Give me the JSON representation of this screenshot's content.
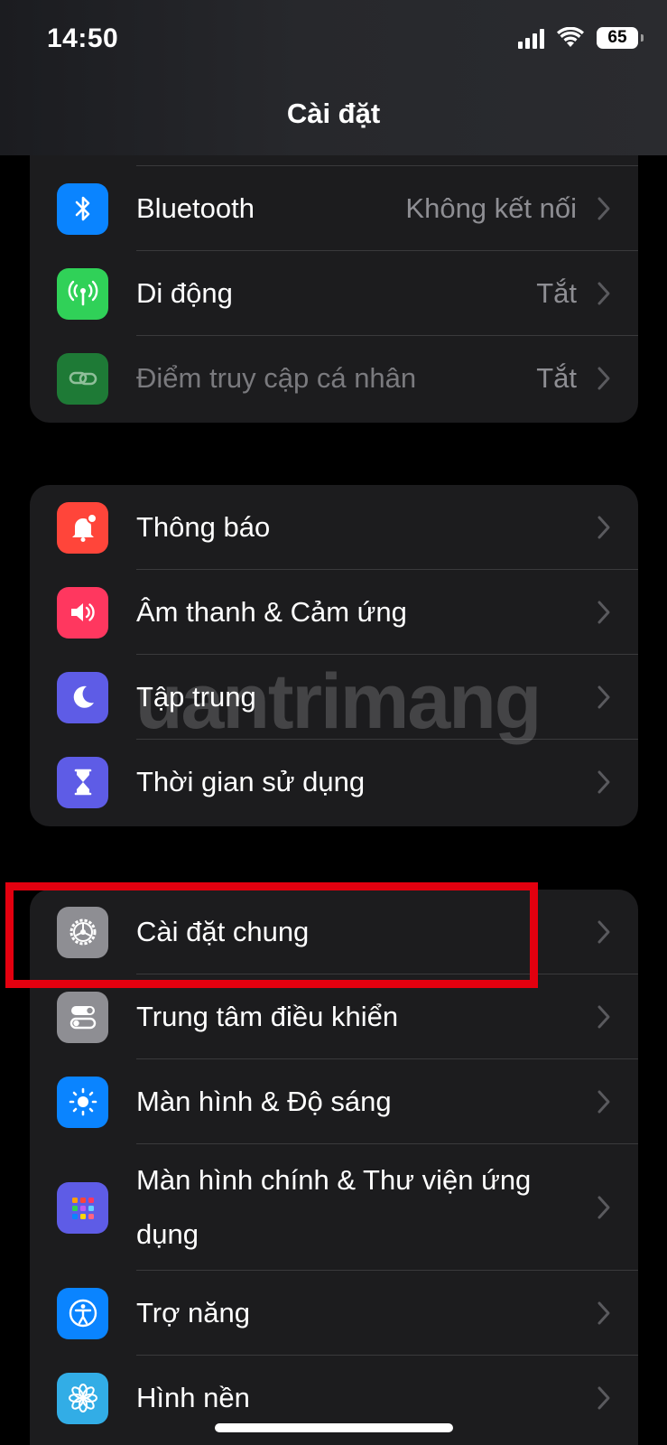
{
  "status_bar": {
    "time": "14:50",
    "battery": "65"
  },
  "nav": {
    "title": "Cài đặt"
  },
  "group1": {
    "bluetooth": {
      "label": "Bluetooth",
      "value": "Không kết nối"
    },
    "mobile": {
      "label": "Di động",
      "value": "Tắt"
    },
    "hotspot": {
      "label": "Điểm truy cập cá nhân",
      "value": "Tắt"
    }
  },
  "group2": {
    "notifications": {
      "label": "Thông báo"
    },
    "sounds": {
      "label": "Âm thanh & Cảm ứng"
    },
    "focus": {
      "label": "Tập trung"
    },
    "screen_time": {
      "label": "Thời gian sử dụng"
    }
  },
  "group3": {
    "general": {
      "label": "Cài đặt chung"
    },
    "control_center": {
      "label": "Trung tâm điều khiển"
    },
    "display": {
      "label": "Màn hình & Độ sáng"
    },
    "home_screen": {
      "label": "Màn hình chính & Thư viện ứng dụng"
    },
    "accessibility": {
      "label": "Trợ năng"
    },
    "wallpaper": {
      "label": "Hình nền"
    }
  },
  "watermark": {
    "text": "uantrimang"
  },
  "colors": {
    "bluetooth": "#0a84ff",
    "mobile": "#30d158",
    "hotspot": "#1e7a36",
    "notifications": "#ff453a",
    "sounds": "#ff375f",
    "focus": "#5e5ce6",
    "screen_time": "#5e5ce6",
    "general": "#8e8e93",
    "control_center": "#8e8e93",
    "display": "#0a84ff",
    "home_screen": "#5e5ce6",
    "accessibility": "#0a84ff",
    "wallpaper": "#32ade6",
    "highlight": "#e3000f"
  }
}
